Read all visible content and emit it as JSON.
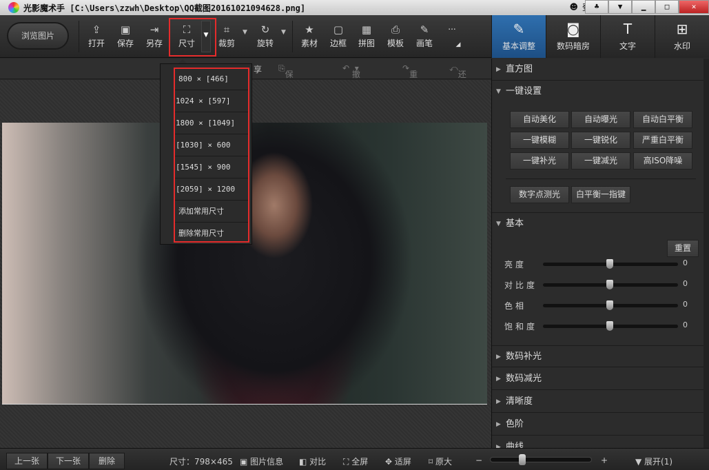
{
  "title": {
    "app": "光影魔术手",
    "path": "[C:\\Users\\zzwh\\Desktop\\QQ截图20161021094628.png]",
    "login": "登录"
  },
  "toolbar": {
    "browse": "浏览图片",
    "open": "打开",
    "save": "保存",
    "save_as": "另存",
    "size": "尺寸",
    "crop": "裁剪",
    "rotate": "旋转",
    "material": "素材",
    "border": "边框",
    "collage": "拼图",
    "template": "模板",
    "brush": "画笔",
    "more": "..."
  },
  "subbar": {
    "share": "享",
    "save_action": "保存动作",
    "undo": "撤销",
    "redo": "重做",
    "restore": "还原"
  },
  "size_menu": [
    "800 × [466]",
    "1024 × [597]",
    "1800 × [1049]",
    "[1030] × 600",
    "[1545] × 900",
    "[2059] × 1200",
    "添加常用尺寸",
    "删除常用尺寸"
  ],
  "right_tabs": [
    "基本调整",
    "数码暗房",
    "文字",
    "水印"
  ],
  "panel": {
    "histogram": "直方图",
    "oneclick": "一键设置",
    "oneclick_buttons": [
      "自动美化",
      "自动曝光",
      "自动白平衡",
      "一键模糊",
      "一键锐化",
      "严重白平衡",
      "一键补光",
      "一键减光",
      "高ISO降噪",
      "数字点测光",
      "白平衡一指键"
    ],
    "basic": "基本",
    "reset": "重置",
    "sliders": [
      {
        "label": "亮度",
        "value": 0
      },
      {
        "label": "对比度",
        "value": 0
      },
      {
        "label": "色相",
        "value": 0
      },
      {
        "label": "饱和度",
        "value": 0
      }
    ],
    "sections": [
      "数码补光",
      "数码减光",
      "清晰度",
      "色阶",
      "曲线"
    ]
  },
  "bottom": {
    "prev": "上一张",
    "next": "下一张",
    "delete": "删除",
    "size": "尺寸：798×465",
    "info": "图片信息",
    "compare": "对比",
    "fullscreen": "全屏",
    "fit": "适屏",
    "original": "原大",
    "minus": "−",
    "plus": "+",
    "expand": "展开(1)",
    "zoom_level": 0.3
  },
  "colors": {
    "accent": "#2f6fae",
    "highlight": "#e52b2b"
  }
}
